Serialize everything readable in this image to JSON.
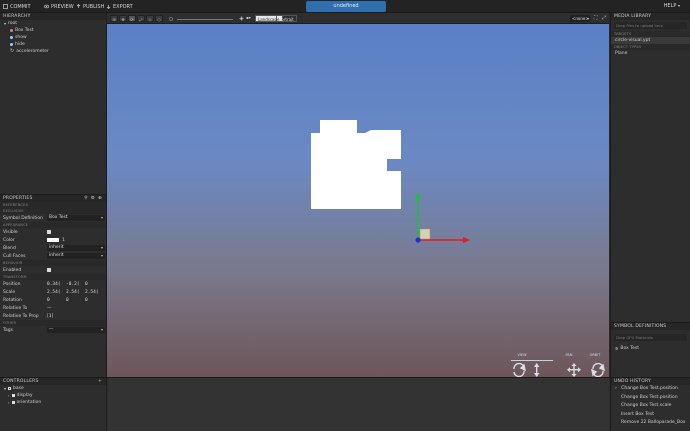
{
  "topbar": {
    "commit": "COMMIT",
    "preview": "PREVIEW",
    "publish": "PUBLISH",
    "export": "EXPORT",
    "doc_title": "undefined",
    "help": "HELP"
  },
  "hierarchy": {
    "title": "HIERARCHY",
    "items": [
      {
        "label": "root"
      },
      {
        "label": "Box Test"
      },
      {
        "label": "show"
      },
      {
        "label": "hide"
      },
      {
        "label": "accelerometer"
      }
    ]
  },
  "properties": {
    "title": "PROPERTIES",
    "sections": {
      "references": "REFERENCES",
      "exclusive": "EXCLUSIVE",
      "appearance": "APPEARANCE",
      "behavior": "BEHAVIOR",
      "transform": "TRANSFORM",
      "other": "OTHER"
    },
    "symbol_definition": {
      "label": "Symbol Definition",
      "value": "Box Test"
    },
    "visible": {
      "label": "Visible"
    },
    "color": {
      "label": "Color",
      "value": "1"
    },
    "blend": {
      "label": "Blend",
      "value": "inherit"
    },
    "cull_faces": {
      "label": "Cull Faces",
      "value": "inherit"
    },
    "enabled": {
      "label": "Enabled"
    },
    "position": {
      "label": "Position",
      "x": "0.34(",
      "y": "-0.2(",
      "z": "0"
    },
    "scale": {
      "label": "Scale",
      "x": "2.54(",
      "y": "2.54(",
      "z": "2.54("
    },
    "rotation": {
      "label": "Rotation",
      "x": "0",
      "y": "0",
      "z": "0"
    },
    "relative_to": {
      "label": "Relative To",
      "value": "—"
    },
    "relative_to_prop": {
      "label": "Relative To Prop",
      "value": "[1]"
    },
    "tags": {
      "label": "Tags",
      "value": "—"
    }
  },
  "controllers": {
    "title": "CONTROLLERS",
    "items": [
      {
        "label": "base"
      },
      {
        "label": "display"
      },
      {
        "label": "orientation"
      }
    ]
  },
  "viewport_toolbar": {
    "landscape": "Landscape",
    "portrait": "Portrait",
    "device": "<none>"
  },
  "nav": {
    "view": "VIEW",
    "pan": "PAN",
    "orbit": "ORBIT"
  },
  "media_library": {
    "title": "MEDIA LIBRARY",
    "search_placeholder": "Drop files to upload here",
    "targets_header": "TARGETS",
    "target_item": "circle-visual.ypt",
    "object_types_header": "OBJECT TYPES",
    "object_item": "Plane"
  },
  "symbol_definitions": {
    "title": "SYMBOL DEFINITIONS",
    "search_placeholder": "Drop GPU Materials",
    "item": "Box Test"
  },
  "undo_history": {
    "title": "UNDO HISTORY",
    "items": [
      {
        "label": "Change Box Test.position"
      },
      {
        "label": "Change Box Test.position"
      },
      {
        "label": "Change Box Test.scale"
      },
      {
        "label": "Insert Box Test"
      },
      {
        "label": "Remove 22 Balloparade_Box"
      }
    ]
  }
}
